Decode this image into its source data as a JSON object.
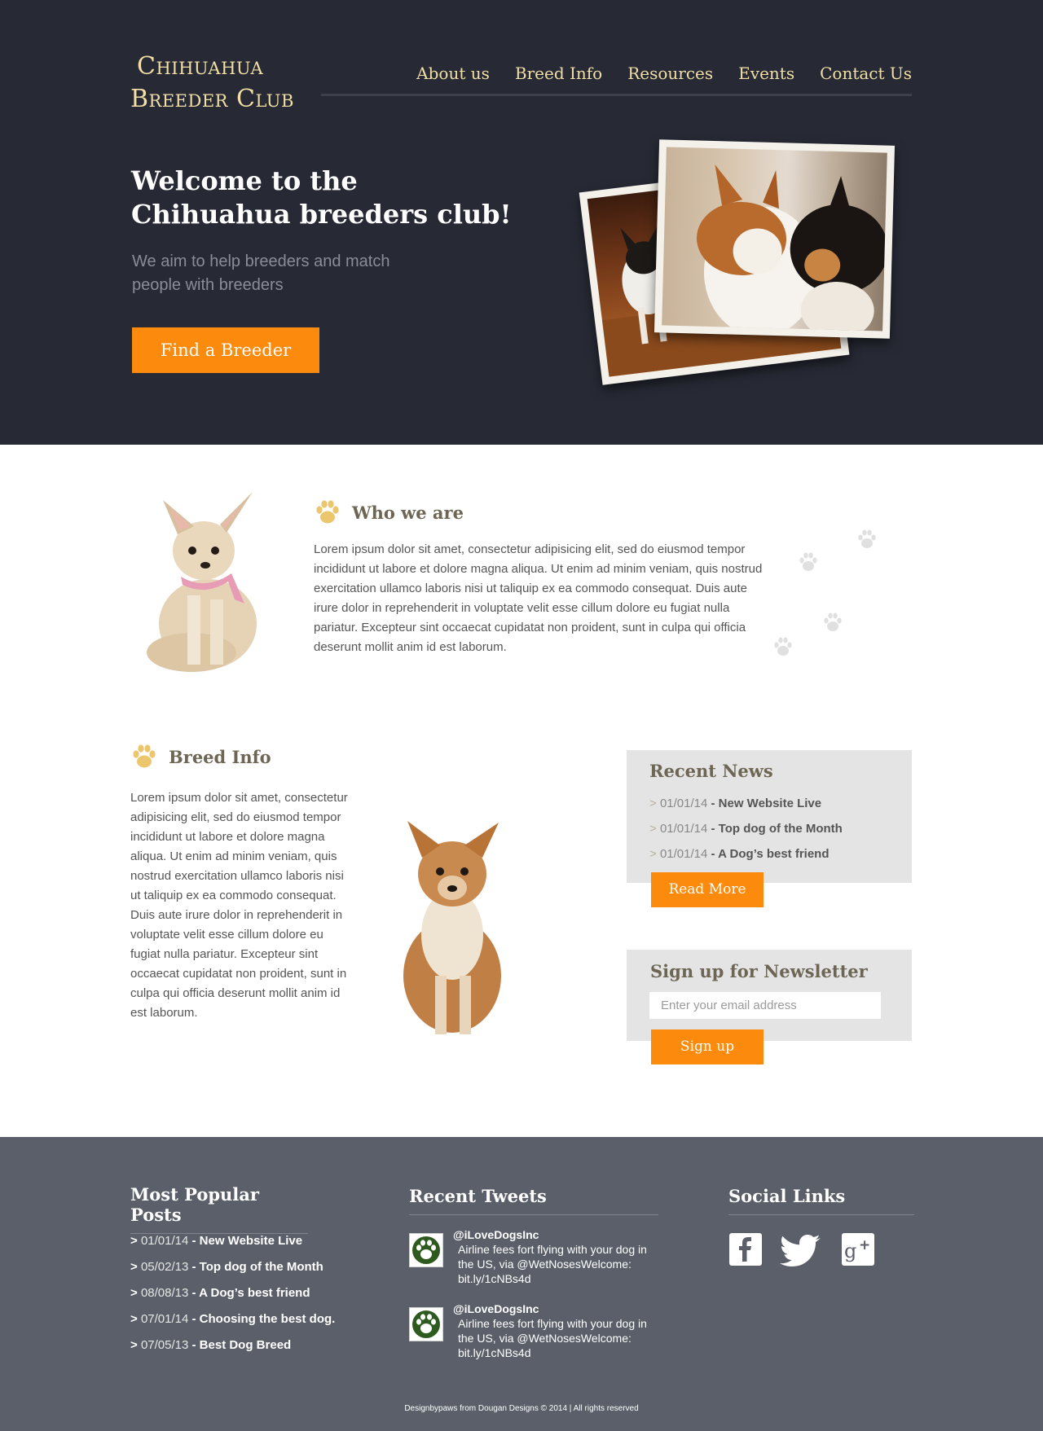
{
  "header": {
    "logo_line1": "Chihuahua",
    "logo_line2": "Breeder Club",
    "nav": [
      "About us",
      "Breed Info",
      "Resources",
      "Events",
      "Contact Us"
    ]
  },
  "hero": {
    "title": "Welcome to the Chihuahua breeders club!",
    "subtitle": "We aim to help breeders and match people with breeders",
    "cta": "Find a Breeder"
  },
  "who": {
    "title": "Who we are",
    "text": "Lorem ipsum dolor sit amet, consectetur adipisicing elit, sed do eiusmod tempor incididunt ut labore et dolore magna aliqua. Ut enim ad minim veniam, quis nostrud exercitation ullamco laboris nisi ut taliquip ex ea commodo consequat. Duis aute irure dolor in reprehenderit in voluptate velit esse cillum dolore eu fugiat nulla pariatur. Excepteur sint occaecat cupidatat non proident, sunt in culpa qui officia deserunt mollit anim id est laborum."
  },
  "breed": {
    "title": "Breed Info",
    "text": "Lorem ipsum dolor sit amet, consectetur adipisicing elit, sed do eiusmod tempor incididunt ut labore et dolore magna aliqua. Ut enim ad minim veniam, quis nostrud exercitation ullamco laboris nisi ut taliquip ex ea commodo consequat. Duis aute irure dolor in reprehenderit in voluptate velit esse cillum dolore eu fugiat nulla pariatur. Excepteur sint occaecat cupidatat non proident, sunt in culpa qui officia deserunt mollit anim id est laborum."
  },
  "news": {
    "title": "Recent News",
    "items": [
      {
        "date": "01/01/14",
        "title": "New Website Live"
      },
      {
        "date": "01/01/14",
        "title": "Top dog of the Month"
      },
      {
        "date": "01/01/14",
        "title": "A Dog’s best friend"
      }
    ],
    "button": "Read More"
  },
  "newsletter": {
    "title": "Sign up for Newsletter",
    "placeholder": "Enter your email address",
    "button": "Sign up"
  },
  "footer": {
    "popular_title": "Most Popular Posts",
    "popular": [
      {
        "date": "01/01/14",
        "title": "New Website Live"
      },
      {
        "date": "05/02/13",
        "title": "Top dog of the Month"
      },
      {
        "date": "08/08/13",
        "title": "A Dog’s best friend"
      },
      {
        "date": "07/01/14",
        "title": "Choosing the best dog."
      },
      {
        "date": "07/05/13",
        "title": "Best Dog Breed"
      }
    ],
    "tweets_title": "Recent Tweets",
    "tweets": [
      {
        "handle": "@iLoveDogsInc",
        "text": "Airline fees fort flying with your dog in the US, via @WetNosesWelcome: bit.ly/1cNBs4d"
      },
      {
        "handle": "@iLoveDogsInc",
        "text": "Airline fees fort flying with your dog in the US, via @WetNosesWelcome: bit.ly/1cNBs4d"
      }
    ],
    "social_title": "Social Links",
    "social": [
      "facebook-icon",
      "twitter-icon",
      "google-plus-icon"
    ],
    "copyright": "Designbypaws from Dougan Designs © 2014 | All rights reserved"
  },
  "colors": {
    "hero_bg": "#272a35",
    "accent": "#fc8a0d",
    "logo": "#f1dfa6",
    "footer_bg": "#5b5f69",
    "box_bg": "#e4e4e4"
  }
}
